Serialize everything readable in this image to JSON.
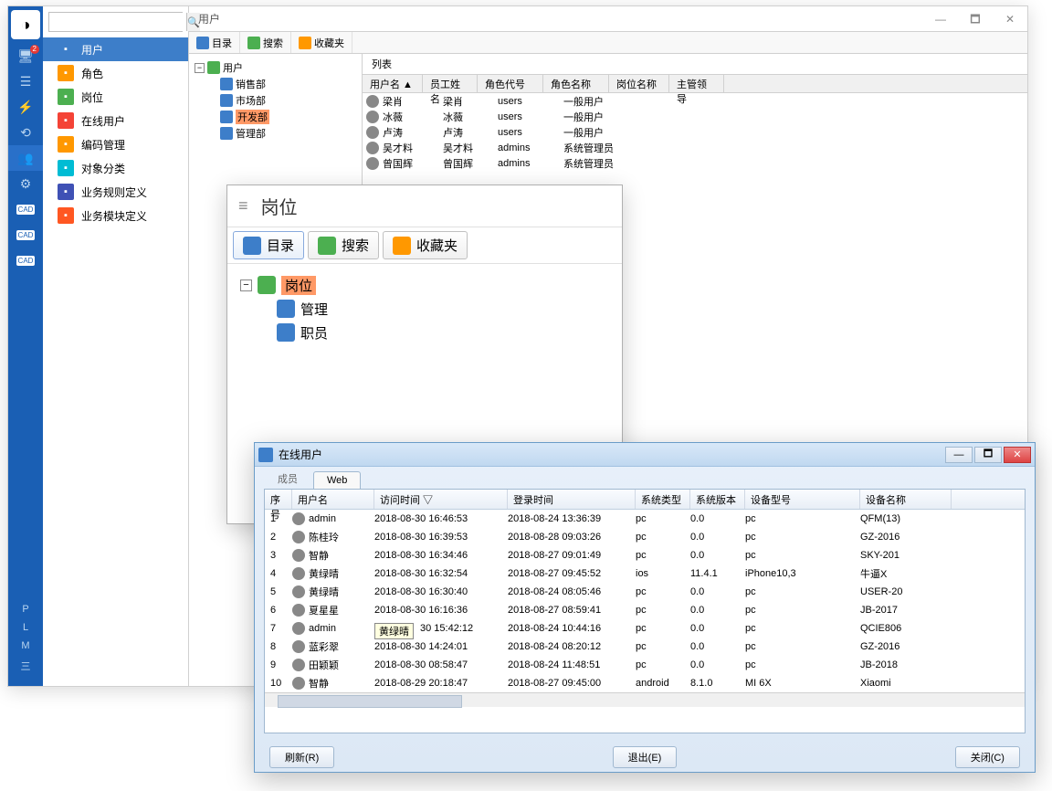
{
  "main": {
    "title": "用户",
    "badge": "2",
    "iconBarLetters": [
      "P",
      "L",
      "M",
      "三"
    ],
    "nav": [
      {
        "label": "用户"
      },
      {
        "label": "角色"
      },
      {
        "label": "岗位"
      },
      {
        "label": "在线用户"
      },
      {
        "label": "编码管理"
      },
      {
        "label": "对象分类"
      },
      {
        "label": "业务规则定义"
      },
      {
        "label": "业务模块定义"
      }
    ],
    "toolbar": {
      "dir": "目录",
      "search": "搜索",
      "fav": "收藏夹"
    },
    "tree": {
      "root": "用户",
      "children": [
        "销售部",
        "市场部",
        "开发部",
        "管理部"
      ],
      "selectedIndex": 2
    },
    "list": {
      "tabLabel": "列表",
      "headers": [
        "用户名 ▲",
        "员工姓名",
        "角色代号",
        "角色名称",
        "岗位名称",
        "主管领导"
      ],
      "rows": [
        [
          "梁肖",
          "梁肖",
          "users",
          "一般用户",
          "",
          ""
        ],
        [
          "冰薇",
          "冰薇",
          "users",
          "一般用户",
          "",
          ""
        ],
        [
          "卢涛",
          "卢涛",
          "users",
          "一般用户",
          "",
          ""
        ],
        [
          "吴才料",
          "吴才料",
          "admins",
          "系统管理员",
          "",
          ""
        ],
        [
          "曾国辉",
          "曾国辉",
          "admins",
          "系统管理员",
          "",
          ""
        ]
      ]
    }
  },
  "posWindow": {
    "title": "岗位",
    "tabs": {
      "dir": "目录",
      "search": "搜索",
      "fav": "收藏夹"
    },
    "tree": {
      "root": "岗位",
      "children": [
        "管理",
        "职员"
      ]
    }
  },
  "onlineWindow": {
    "title": "在线用户",
    "tabs": [
      "成员",
      "Web"
    ],
    "activeTab": 1,
    "headers": [
      "序号",
      "用户名",
      "访问时间 ▽",
      "登录时间",
      "系统类型",
      "系统版本",
      "设备型号",
      "设备名称"
    ],
    "rows": [
      [
        "1",
        "admin",
        "2018-08-30 16:46:53",
        "2018-08-24 13:36:39",
        "pc",
        "0.0",
        "pc",
        "QFM(13)"
      ],
      [
        "2",
        "陈桂玲",
        "2018-08-30 16:39:53",
        "2018-08-28 09:03:26",
        "pc",
        "0.0",
        "pc",
        "GZ-2016"
      ],
      [
        "3",
        "智静",
        "2018-08-30 16:34:46",
        "2018-08-27 09:01:49",
        "pc",
        "0.0",
        "pc",
        "SKY-201"
      ],
      [
        "4",
        "黄绿晴",
        "2018-08-30 16:32:54",
        "2018-08-27 09:45:52",
        "ios",
        "11.4.1",
        "iPhone10,3",
        "牛逼X"
      ],
      [
        "5",
        "黄绿晴",
        "2018-08-30 16:30:40",
        "2018-08-24 08:05:46",
        "pc",
        "0.0",
        "pc",
        "USER-20"
      ],
      [
        "6",
        "夏星星",
        "2018-08-30 16:16:36",
        "2018-08-27 08:59:41",
        "pc",
        "0.0",
        "pc",
        "JB-2017"
      ],
      [
        "7",
        "admin",
        "",
        "2018-08-24 10:44:16",
        "pc",
        "0.0",
        "pc",
        "QCIE806"
      ],
      [
        "8",
        "蓝彩翠",
        "2018-08-30 14:24:01",
        "2018-08-24 08:20:12",
        "pc",
        "0.0",
        "pc",
        "GZ-2016"
      ],
      [
        "9",
        "田颖颖",
        "2018-08-30 08:58:47",
        "2018-08-24 11:48:51",
        "pc",
        "0.0",
        "pc",
        "JB-2018"
      ],
      [
        "10",
        "智静",
        "2018-08-29 20:18:47",
        "2018-08-27 09:45:00",
        "android",
        "8.1.0",
        "MI 6X",
        "Xiaomi"
      ]
    ],
    "tooltipRow": 6,
    "tooltipText": "黄绿晴",
    "tooltipTime": "30 15:42:12",
    "buttons": {
      "refresh": "刷新(R)",
      "exit": "退出(E)",
      "close": "关闭(C)"
    }
  }
}
